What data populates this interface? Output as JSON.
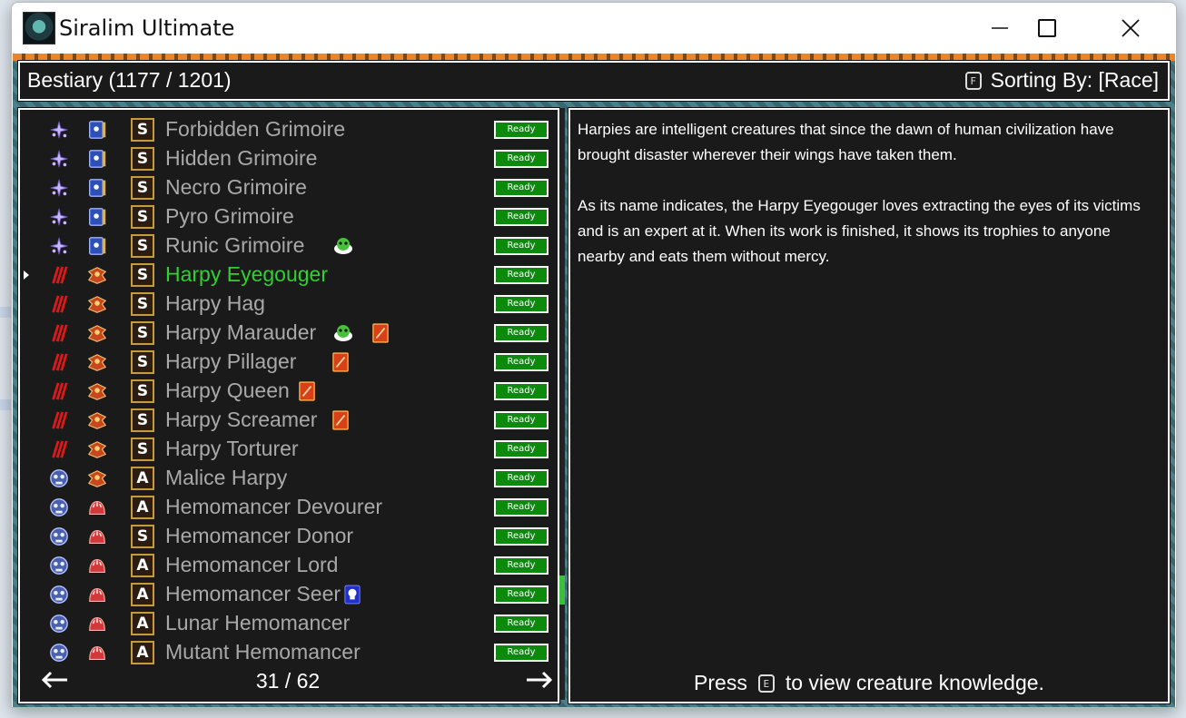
{
  "window": {
    "title": "Siralim Ultimate"
  },
  "header": {
    "bestiary_label": "Bestiary (1177 / 1201)",
    "sort_key": "F",
    "sorting_label": "Sorting By: [Race]"
  },
  "list": {
    "status_label": "Ready",
    "rows": [
      {
        "name": "Forbidden Grimoire",
        "class": "sorcery",
        "race": "grimoire",
        "type": "S",
        "extras": []
      },
      {
        "name": "Hidden Grimoire",
        "class": "sorcery",
        "race": "grimoire",
        "type": "S",
        "extras": []
      },
      {
        "name": "Necro Grimoire",
        "class": "sorcery",
        "race": "grimoire",
        "type": "S",
        "extras": []
      },
      {
        "name": "Pyro Grimoire",
        "class": "sorcery",
        "race": "grimoire",
        "type": "S",
        "extras": []
      },
      {
        "name": "Runic Grimoire",
        "class": "sorcery",
        "race": "grimoire",
        "type": "S",
        "extras": [
          "slime-icon"
        ]
      },
      {
        "name": "Harpy Eyegouger",
        "class": "chaos",
        "race": "harpy",
        "type": "S",
        "extras": [],
        "selected": true
      },
      {
        "name": "Harpy Hag",
        "class": "chaos",
        "race": "harpy",
        "type": "S",
        "extras": []
      },
      {
        "name": "Harpy Marauder",
        "class": "chaos",
        "race": "harpy",
        "type": "S",
        "extras": [
          "slime-icon",
          "card-icon"
        ]
      },
      {
        "name": "Harpy Pillager",
        "class": "chaos",
        "race": "harpy",
        "type": "S",
        "extras": [
          "card-icon"
        ]
      },
      {
        "name": "Harpy Queen",
        "class": "chaos",
        "race": "harpy",
        "type": "S",
        "extras": [
          "card-icon"
        ]
      },
      {
        "name": "Harpy Screamer",
        "class": "chaos",
        "race": "harpy",
        "type": "S",
        "extras": [
          "card-icon"
        ]
      },
      {
        "name": "Harpy Torturer",
        "class": "chaos",
        "race": "harpy",
        "type": "S",
        "extras": []
      },
      {
        "name": "Malice Harpy",
        "class": "death",
        "race": "harpy",
        "type": "A",
        "extras": []
      },
      {
        "name": "Hemomancer Devourer",
        "class": "death",
        "race": "hemomancer",
        "type": "A",
        "extras": []
      },
      {
        "name": "Hemomancer Donor",
        "class": "death",
        "race": "hemomancer",
        "type": "S",
        "extras": []
      },
      {
        "name": "Hemomancer Lord",
        "class": "death",
        "race": "hemomancer",
        "type": "A",
        "extras": []
      },
      {
        "name": "Hemomancer Seer",
        "class": "death",
        "race": "hemomancer",
        "type": "A",
        "extras": [
          "skull-card-icon"
        ]
      },
      {
        "name": "Lunar Hemomancer",
        "class": "death",
        "race": "hemomancer",
        "type": "A",
        "extras": []
      },
      {
        "name": "Mutant Hemomancer",
        "class": "death",
        "race": "hemomancer",
        "type": "A",
        "extras": []
      }
    ],
    "pagination": {
      "page_text": "31 / 62",
      "prev_icon": "left-arrow-icon",
      "next_icon": "right-arrow-icon"
    }
  },
  "description": {
    "paragraphs": [
      "Harpies are intelligent creatures that since the dawn of human civilization have brought disaster wherever their wings have taken them.",
      "As its name indicates, the Harpy Eyegouger loves extracting the eyes of its victims and is an expert at it. When its work is finished, it shows its trophies to anyone nearby and eats them without mercy."
    ],
    "press_label": "Press",
    "press_key": "E",
    "press_suffix": "to view creature knowledge."
  },
  "colors": {
    "selected_name": "#2fd02f",
    "ready_bg": "#0c8a0c",
    "panel_bg": "#1a1a1a"
  }
}
